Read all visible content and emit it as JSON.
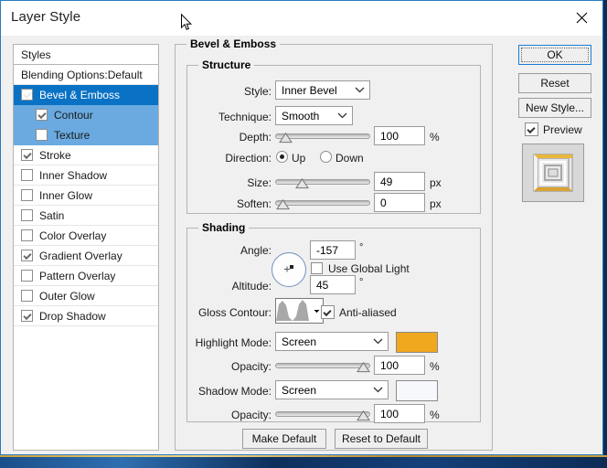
{
  "window": {
    "title": "Layer Style",
    "close_icon": "close-icon"
  },
  "styles_panel": {
    "header": "Styles",
    "blending_options": "Blending Options:Default",
    "items": [
      {
        "label": "Bevel & Emboss",
        "checked": true,
        "selected": true,
        "sub": false
      },
      {
        "label": "Contour",
        "checked": true,
        "selected": false,
        "sub": true
      },
      {
        "label": "Texture",
        "checked": false,
        "selected": false,
        "sub": true
      },
      {
        "label": "Stroke",
        "checked": true,
        "selected": false,
        "sub": false
      },
      {
        "label": "Inner Shadow",
        "checked": false,
        "selected": false,
        "sub": false
      },
      {
        "label": "Inner Glow",
        "checked": false,
        "selected": false,
        "sub": false
      },
      {
        "label": "Satin",
        "checked": false,
        "selected": false,
        "sub": false
      },
      {
        "label": "Color Overlay",
        "checked": false,
        "selected": false,
        "sub": false
      },
      {
        "label": "Gradient Overlay",
        "checked": true,
        "selected": false,
        "sub": false
      },
      {
        "label": "Pattern Overlay",
        "checked": false,
        "selected": false,
        "sub": false
      },
      {
        "label": "Outer Glow",
        "checked": false,
        "selected": false,
        "sub": false
      },
      {
        "label": "Drop Shadow",
        "checked": true,
        "selected": false,
        "sub": false
      }
    ]
  },
  "main": {
    "section_title": "Bevel & Emboss",
    "structure": {
      "title": "Structure",
      "style_label": "Style:",
      "style_value": "Inner Bevel",
      "technique_label": "Technique:",
      "technique_value": "Smooth",
      "depth_label": "Depth:",
      "depth_value": "100",
      "depth_unit": "%",
      "depth_percent": 4,
      "direction_label": "Direction:",
      "direction_up": "Up",
      "direction_down": "Down",
      "direction_selected": "Up",
      "size_label": "Size:",
      "size_value": "49",
      "size_unit": "px",
      "size_percent": 25,
      "soften_label": "Soften:",
      "soften_value": "0",
      "soften_unit": "px",
      "soften_percent": 1
    },
    "shading": {
      "title": "Shading",
      "angle_label": "Angle:",
      "angle_value": "-157",
      "angle_unit": "°",
      "use_global_light": "Use Global Light",
      "use_global_light_checked": false,
      "altitude_label": "Altitude:",
      "altitude_value": "45",
      "altitude_unit": "°",
      "gloss_contour_label": "Gloss Contour:",
      "anti_aliased": "Anti-aliased",
      "anti_aliased_checked": true,
      "highlight_mode_label": "Highlight Mode:",
      "highlight_mode_value": "Screen",
      "highlight_color": "#f0a81e",
      "highlight_opacity_label": "Opacity:",
      "highlight_opacity_value": "100",
      "highlight_opacity_unit": "%",
      "highlight_opacity_percent": 100,
      "shadow_mode_label": "Shadow Mode:",
      "shadow_mode_value": "Screen",
      "shadow_color": "#f6f8fb",
      "shadow_opacity_label": "Opacity:",
      "shadow_opacity_value": "100",
      "shadow_opacity_unit": "%",
      "shadow_opacity_percent": 100
    },
    "make_default": "Make Default",
    "reset_to_default": "Reset to Default"
  },
  "side_buttons": {
    "ok": "OK",
    "reset": "Reset",
    "new_style": "New Style...",
    "preview_label": "Preview",
    "preview_checked": true
  }
}
